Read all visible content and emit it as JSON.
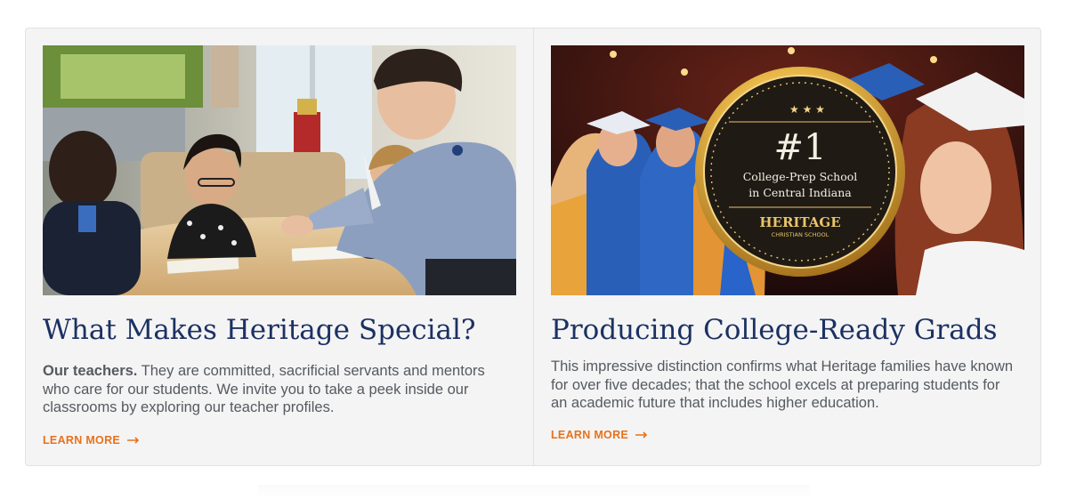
{
  "cards": [
    {
      "title": "What Makes Heritage Special?",
      "lead": "Our teachers.",
      "body": " They are committed, sacrificial servants and mentors who care for our students. We invite you to take a peek inside our classrooms by exploring our teacher profiles.",
      "link": "LEARN MORE",
      "image": "classroom-photo"
    },
    {
      "title": "Producing College-Ready Grads",
      "body": "This impressive distinction confirms what Heritage families have known for over five decades; that the school excels at preparing students for an academic future that includes higher education.",
      "link": "LEARN MORE",
      "image": "graduation-photo",
      "badge": {
        "rank": "#1",
        "line1": "College-Prep School",
        "line2": "in Central Indiana",
        "brand": "HERITAGE",
        "brand_sub": "CHRISTIAN SCHOOL"
      }
    }
  ],
  "colors": {
    "title": "#1c3163",
    "text": "#555a60",
    "accent": "#e8711c",
    "panel": "#f4f4f4"
  }
}
